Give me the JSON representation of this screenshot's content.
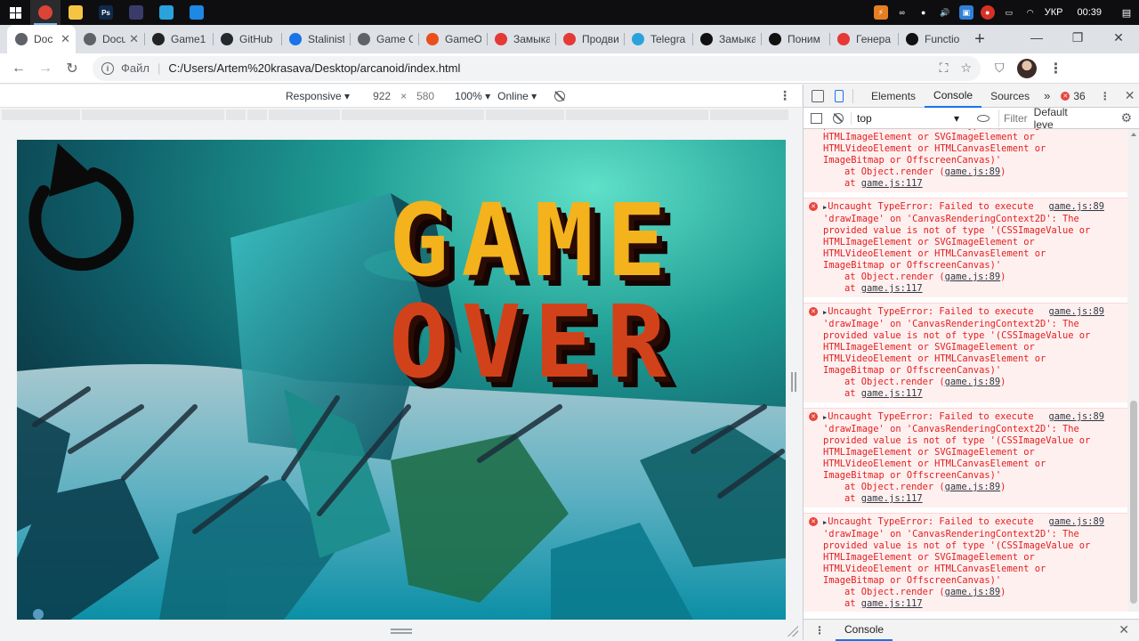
{
  "colors": {
    "accent": "#1a73e8",
    "error_red": "#e8453c",
    "error_bg": "#fff0f0",
    "game_yellow": "#f4b21c",
    "game_red": "#d2421a"
  },
  "taskbar": {
    "apps": [
      {
        "name": "chrome-icon",
        "color": "#db4437",
        "glyph": ""
      },
      {
        "name": "file-explorer-icon",
        "color": "#f5c542",
        "glyph": ""
      },
      {
        "name": "photoshop-icon",
        "color": "#0f2a4a",
        "glyph": "Ps"
      },
      {
        "name": "obs-icon",
        "color": "#3b3b6b",
        "glyph": ""
      },
      {
        "name": "telegram-icon",
        "color": "#2aa3dd",
        "glyph": ""
      },
      {
        "name": "vscode-icon",
        "color": "#1e88e5",
        "glyph": ""
      }
    ],
    "language": "УКР",
    "time": "00:39"
  },
  "tabs": [
    {
      "label": "Doc",
      "fav_color": "#5f6368",
      "fav_name": "globe-icon"
    },
    {
      "label": "Docum",
      "fav_color": "#5f6368",
      "fav_name": "globe-icon"
    },
    {
      "label": "Game1",
      "fav_color": "#222222",
      "fav_name": "codepen-icon"
    },
    {
      "label": "GitHub",
      "fav_color": "#24292e",
      "fav_name": "github-icon"
    },
    {
      "label": "Stalinist",
      "fav_color": "#1a73e8",
      "fav_name": "f-icon"
    },
    {
      "label": "Game C",
      "fav_color": "#5f6368",
      "fav_name": "globe-icon"
    },
    {
      "label": "GameO",
      "fav_color": "#e94e1b",
      "fav_name": "gameo-icon"
    },
    {
      "label": "Замыка",
      "fav_color": "#e53935",
      "fav_name": "person-icon"
    },
    {
      "label": "Продви",
      "fav_color": "#e53935",
      "fav_name": "person-icon"
    },
    {
      "label": "Telegra",
      "fav_color": "#2aa3dd",
      "fav_name": "telegram-icon"
    },
    {
      "label": "Замыка",
      "fav_color": "#111111",
      "fav_name": "bookmark-icon"
    },
    {
      "label": "Поним",
      "fav_color": "#111111",
      "fav_name": "video-icon"
    },
    {
      "label": "Генера",
      "fav_color": "#e53935",
      "fav_name": "person-icon"
    },
    {
      "label": "Functio",
      "fav_color": "#111111",
      "fav_name": "f-square-icon"
    }
  ],
  "address": {
    "scheme_label": "Файл",
    "url": "C:/Users/Artem%20krasava/Desktop/arcanoid/index.html"
  },
  "device_toolbar": {
    "mode": "Responsive",
    "width": "922",
    "times": "×",
    "height": "580",
    "zoom": "100%",
    "network": "Online"
  },
  "game": {
    "line1": "GAME",
    "line2": "OVER"
  },
  "devtools": {
    "tabs": [
      "Elements",
      "Console",
      "Sources"
    ],
    "active_tab": "Console",
    "more": "»",
    "error_count": "36",
    "context": "top",
    "filter_placeholder": "Filter",
    "levels": "Default leve",
    "drawer_tab": "Console"
  },
  "console": {
    "partial_message": {
      "lines": [
        "provided value is not of type '(CSSImageValue or",
        "HTMLImageElement or SVGImageElement or",
        "HTMLVideoElement or HTMLCanvasElement or",
        "ImageBitmap or OffscreenCanvas)'"
      ],
      "stack": [
        {
          "prefix": "at Object.render (",
          "link": "game.js:89",
          "suffix": ")"
        },
        {
          "prefix": "at ",
          "link": "game.js:117",
          "suffix": ""
        }
      ]
    },
    "messages": [
      {
        "source": "game.js:89",
        "lines": [
          "Uncaught TypeError: Failed to execute",
          "'drawImage' on 'CanvasRenderingContext2D': The",
          "provided value is not of type '(CSSImageValue or",
          "HTMLImageElement or SVGImageElement or",
          "HTMLVideoElement or HTMLCanvasElement or",
          "ImageBitmap or OffscreenCanvas)'"
        ],
        "stack": [
          {
            "prefix": "at Object.render (",
            "link": "game.js:89",
            "suffix": ")"
          },
          {
            "prefix": "at ",
            "link": "game.js:117",
            "suffix": ""
          }
        ]
      },
      {
        "source": "game.js:89",
        "lines": [
          "Uncaught TypeError: Failed to execute",
          "'drawImage' on 'CanvasRenderingContext2D': The",
          "provided value is not of type '(CSSImageValue or",
          "HTMLImageElement or SVGImageElement or",
          "HTMLVideoElement or HTMLCanvasElement or",
          "ImageBitmap or OffscreenCanvas)'"
        ],
        "stack": [
          {
            "prefix": "at Object.render (",
            "link": "game.js:89",
            "suffix": ")"
          },
          {
            "prefix": "at ",
            "link": "game.js:117",
            "suffix": ""
          }
        ]
      },
      {
        "source": "game.js:89",
        "lines": [
          "Uncaught TypeError: Failed to execute",
          "'drawImage' on 'CanvasRenderingContext2D': The",
          "provided value is not of type '(CSSImageValue or",
          "HTMLImageElement or SVGImageElement or",
          "HTMLVideoElement or HTMLCanvasElement or",
          "ImageBitmap or OffscreenCanvas)'"
        ],
        "stack": [
          {
            "prefix": "at Object.render (",
            "link": "game.js:89",
            "suffix": ")"
          },
          {
            "prefix": "at ",
            "link": "game.js:117",
            "suffix": ""
          }
        ]
      },
      {
        "source": "game.js:89",
        "lines": [
          "Uncaught TypeError: Failed to execute",
          "'drawImage' on 'CanvasRenderingContext2D': The",
          "provided value is not of type '(CSSImageValue or",
          "HTMLImageElement or SVGImageElement or",
          "HTMLVideoElement or HTMLCanvasElement or",
          "ImageBitmap or OffscreenCanvas)'"
        ],
        "stack": [
          {
            "prefix": "at Object.render (",
            "link": "game.js:89",
            "suffix": ")"
          },
          {
            "prefix": "at ",
            "link": "game.js:117",
            "suffix": ""
          }
        ]
      }
    ],
    "prompt": "›"
  }
}
